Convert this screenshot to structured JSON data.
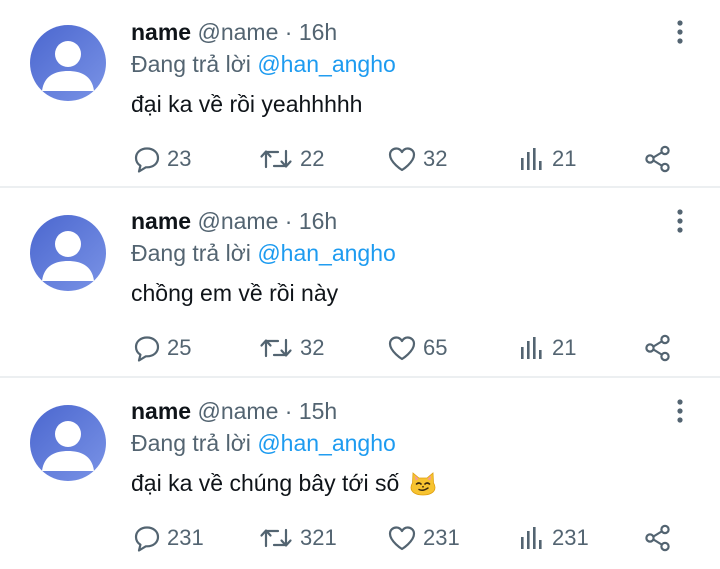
{
  "colors": {
    "text": "#0f1419",
    "secondary": "#536471",
    "mention": "#1d9bf0",
    "avatar": "#5b78d8",
    "divider": "#eceff1"
  },
  "tweets": [
    {
      "name": "name",
      "handle": "@name",
      "separator": "·",
      "time": "16h",
      "reply_prefix": "Đang trả lời",
      "reply_to": "@han_angho",
      "text": "đại ka về rồi yeahhhhh",
      "emoji": "",
      "replies": "23",
      "retweets": "22",
      "likes": "32",
      "views": "21"
    },
    {
      "name": "name",
      "handle": "@name",
      "separator": "·",
      "time": "16h",
      "reply_prefix": "Đang trả lời",
      "reply_to": "@han_angho",
      "text": "chồng em về rồi này",
      "emoji": "",
      "replies": "25",
      "retweets": "32",
      "likes": "65",
      "views": "21"
    },
    {
      "name": "name",
      "handle": "@name",
      "separator": "·",
      "time": "15h",
      "reply_prefix": "Đang trả lời",
      "reply_to": "@han_angho",
      "text": "đại ka về chúng bây tới số",
      "emoji": "smirking-cat-face-icon",
      "replies": "231",
      "retweets": "321",
      "likes": "231",
      "views": "231"
    }
  ]
}
